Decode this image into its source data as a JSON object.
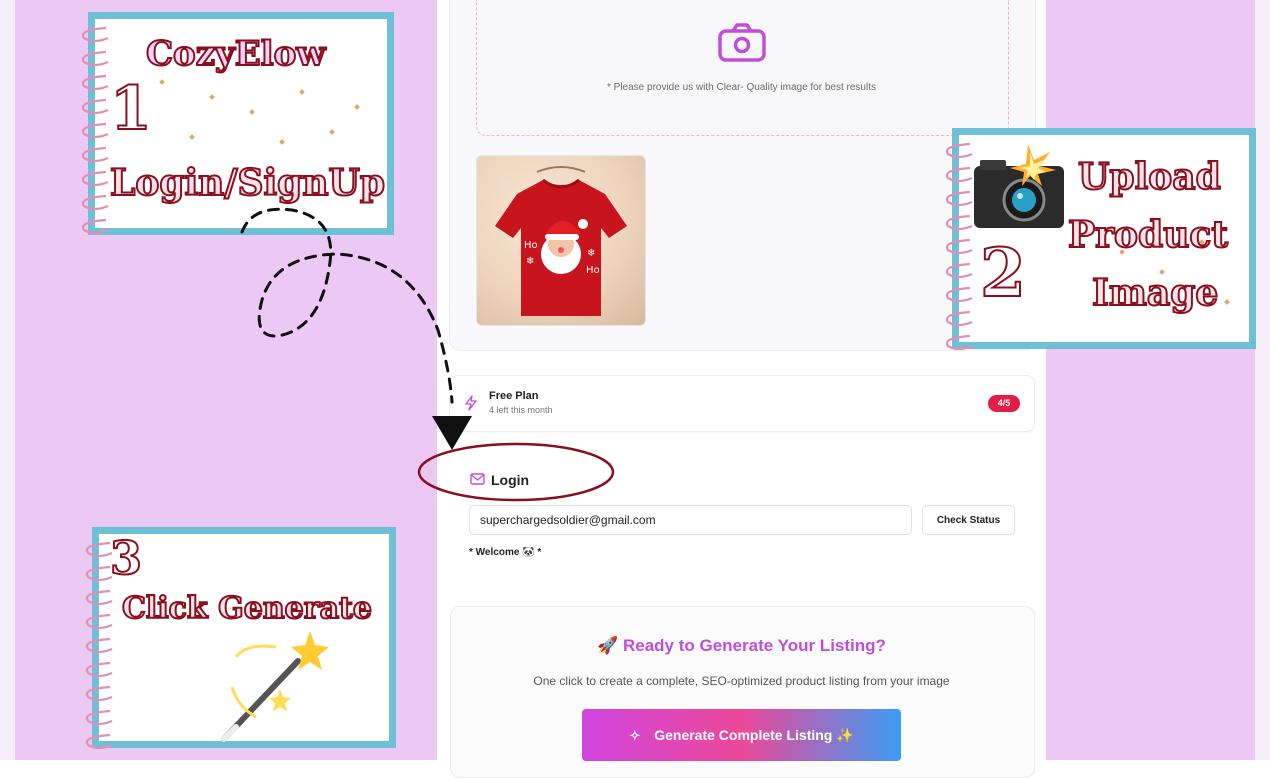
{
  "upload": {
    "hint": "* Please provide us with Clear- Quality image for best results",
    "thumbnail_text": [
      "Ho",
      "Ho"
    ]
  },
  "plan": {
    "title": "Free Plan",
    "subtitle": "4 left this month",
    "badge": "4/5"
  },
  "login": {
    "title": "Login",
    "email": "superchargedsoldier@gmail.com",
    "check_label": "Check Status",
    "welcome": "* Welcome 🐼 *"
  },
  "generate": {
    "title": "🚀 Ready to Generate Your Listing?",
    "subtitle": "One click to create a complete, SEO-optimized product listing from your image",
    "button_label": "Generate Complete Listing ✨",
    "button_icon": "✧"
  },
  "annotations": {
    "step1": {
      "brand": "CozyElow",
      "number": "1",
      "label": "Login/SignUp"
    },
    "step2": {
      "line1": "Upload",
      "line2": "Product",
      "line3": "Image",
      "number": "2"
    },
    "step3": {
      "number": "3",
      "label": "Click Generate"
    }
  },
  "colors": {
    "background": "#ecc8f5",
    "accent_pink": "#c04fd8",
    "badge_red": "#e11d48",
    "annotation_text": "#8a0f1e",
    "notebook_border": "#6ec0d6"
  }
}
